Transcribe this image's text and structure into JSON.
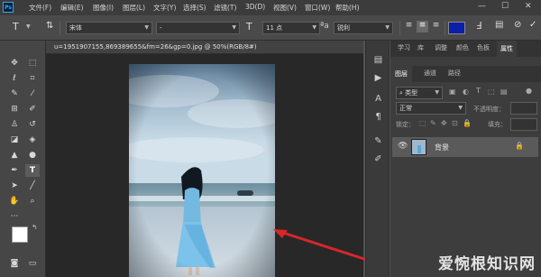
{
  "app": {
    "logo": "Ps"
  },
  "menu": [
    "文件(F)",
    "编辑(E)",
    "图像(I)",
    "图层(L)",
    "文字(Y)",
    "选择(S)",
    "滤镜(T)",
    "3D(D)",
    "视图(V)",
    "窗口(W)",
    "帮助(H)"
  ],
  "window_controls": {
    "minimize": "—",
    "restore": "☐",
    "close": "✕"
  },
  "options": {
    "font_family": "宋体",
    "font_size": "11 点",
    "antialias": "锐利",
    "text_color": "#0b1fa8"
  },
  "document": {
    "tab_title": "u=1951907155,869389655&fm=26&gp=0.jpg @ 50%(RGB/8#)"
  },
  "panels": {
    "top_tabs": [
      "学习",
      "库",
      "调整",
      "颜色",
      "色板",
      "属性"
    ],
    "layer_tabs": [
      "图层",
      "通道",
      "路径"
    ],
    "kind_label": "类型",
    "blend_mode": "正常",
    "opacity_label": "不透明度：",
    "lock_label": "锁定：",
    "fill_label": "填充：",
    "layer_name": "背景"
  },
  "watermark": "爱惋根知识网"
}
